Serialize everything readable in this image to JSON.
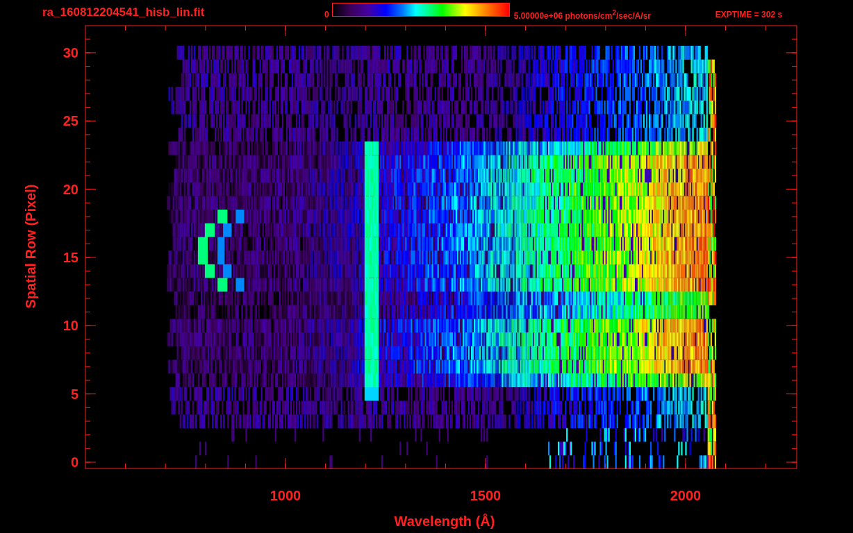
{
  "title": "ra_160812204541_hisb_lin.fit",
  "colorbar": {
    "min_label": "0",
    "max_label": "5.00000e+06 photons/cm$^{2}$/sec/A/sr"
  },
  "exposure": "EXPTIME = 302 s",
  "plot": {
    "xlabel": "Wavelength (Å)",
    "ylabel": "Spatial Row (Pixel)",
    "xticks": [
      "1000",
      "1500",
      "2000"
    ],
    "yticks": [
      "30",
      "25",
      "20",
      "15",
      "10",
      "5",
      "0"
    ]
  }
}
